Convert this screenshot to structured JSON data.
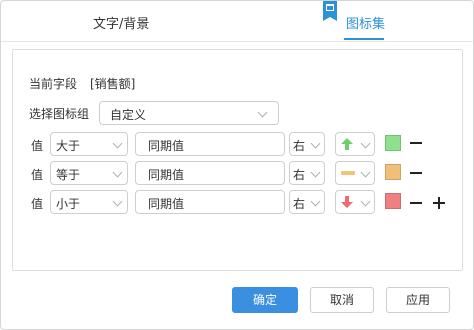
{
  "tabs": [
    {
      "label": "文字/背景",
      "active": false
    },
    {
      "label": "图标集",
      "active": true
    }
  ],
  "field": {
    "label": "当前字段",
    "value": "[销售额]"
  },
  "icon_group": {
    "label": "选择图标组",
    "value": "自定义"
  },
  "rules": [
    {
      "label": "值",
      "operator": "大于",
      "compare": "同期值",
      "position": "右",
      "icon": "arrow-up-icon",
      "icon_color": "#6ccf6c",
      "color": "#8ee08e"
    },
    {
      "label": "值",
      "operator": "等于",
      "compare": "同期值",
      "position": "右",
      "icon": "dash-icon",
      "icon_color": "#f2c47a",
      "color": "#f0c07a"
    },
    {
      "label": "值",
      "operator": "小于",
      "compare": "同期值",
      "position": "右",
      "icon": "arrow-down-icon",
      "icon_color": "#f06a6a",
      "color": "#f08080"
    }
  ],
  "buttons": {
    "confirm": "确定",
    "cancel": "取消",
    "apply": "应用"
  },
  "colors": {
    "accent": "#2c92d6",
    "primary_button": "#3a8fe0"
  }
}
